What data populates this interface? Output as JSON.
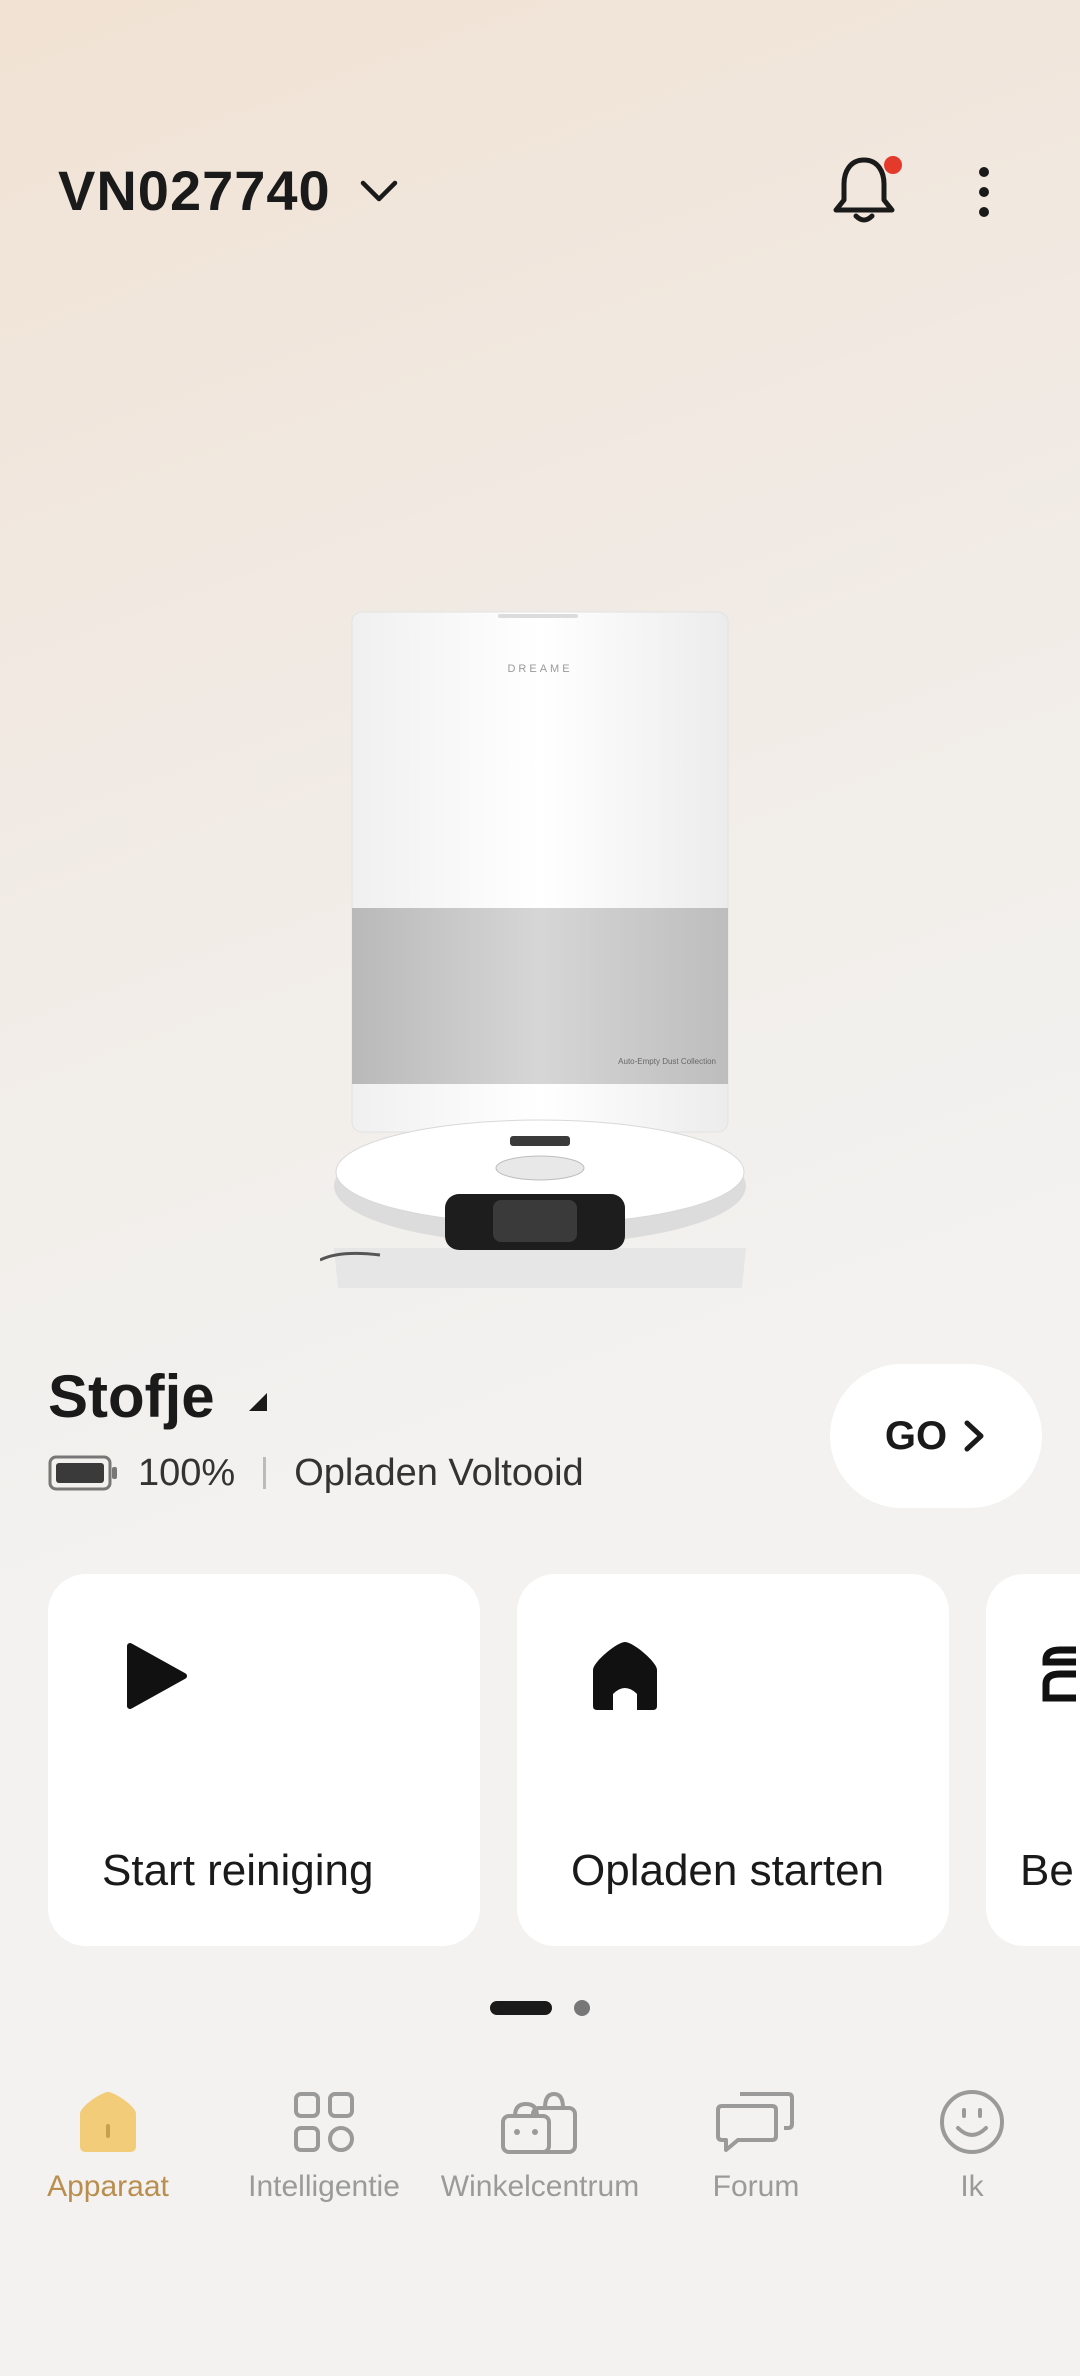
{
  "header": {
    "device_name": "VN027740",
    "notification_badge_color": "#e33a2c"
  },
  "robot": {
    "name": "Stofje",
    "battery_percent": "100%",
    "battery_level": 1.0,
    "status": "Opladen Voltooid",
    "go_label": "GO"
  },
  "product_image": {
    "brand_text": "DREAME",
    "panel_text": "Auto-Empty Dust Collection"
  },
  "actions": [
    {
      "label": "Start reiniging",
      "icon": "play-icon"
    },
    {
      "label": "Opladen starten",
      "icon": "home-charge-icon"
    },
    {
      "label": "Be",
      "icon": "mop-icon"
    }
  ],
  "pager": {
    "pages": 2,
    "current": 1
  },
  "nav": {
    "items": [
      {
        "label": "Apparaat",
        "icon": "device-home-icon",
        "active": true
      },
      {
        "label": "Intelligentie",
        "icon": "grid-icon",
        "active": false
      },
      {
        "label": "Winkelcentrum",
        "icon": "shopping-bag-icon",
        "active": false
      },
      {
        "label": "Forum",
        "icon": "chat-bubbles-icon",
        "active": false
      },
      {
        "label": "Ik",
        "icon": "smiley-icon",
        "active": false
      }
    ],
    "active_color": "#b98e4e",
    "inactive_color": "#9a9a9a"
  }
}
